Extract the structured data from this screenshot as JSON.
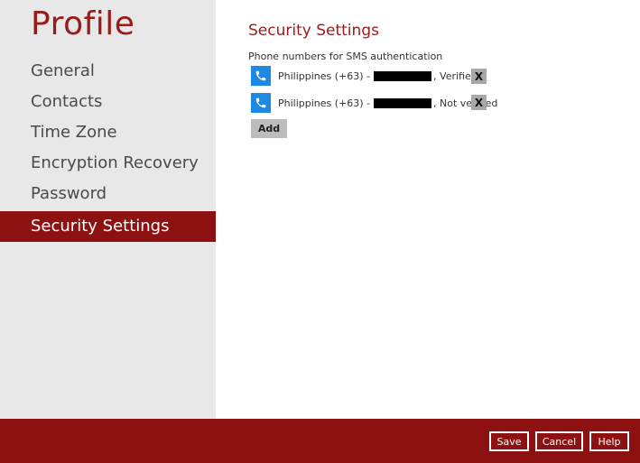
{
  "sidebar": {
    "title": "Profile",
    "items": [
      {
        "label": "General"
      },
      {
        "label": "Contacts"
      },
      {
        "label": "Time Zone"
      },
      {
        "label": "Encryption Recovery"
      },
      {
        "label": "Password"
      },
      {
        "label": "Security Settings",
        "active": true
      }
    ]
  },
  "main": {
    "title": "Security Settings",
    "subtitle": "Phone numbers for SMS authentication",
    "phones": [
      {
        "country": "Philippines (+63) -",
        "status": ", Verified",
        "remove_label": "X",
        "icon": "phone-icon"
      },
      {
        "country": "Philippines (+63) -",
        "status": ", Not verified",
        "remove_label": "X",
        "icon": "phone-icon"
      }
    ],
    "add_label": "Add"
  },
  "footer": {
    "save_label": "Save",
    "cancel_label": "Cancel",
    "help_label": "Help"
  },
  "colors": {
    "accent": "#8e1111",
    "title_red": "#9b1a1a",
    "phone_icon_blue": "#1e88e5",
    "sidebar_bg": "#e8e8e8"
  }
}
